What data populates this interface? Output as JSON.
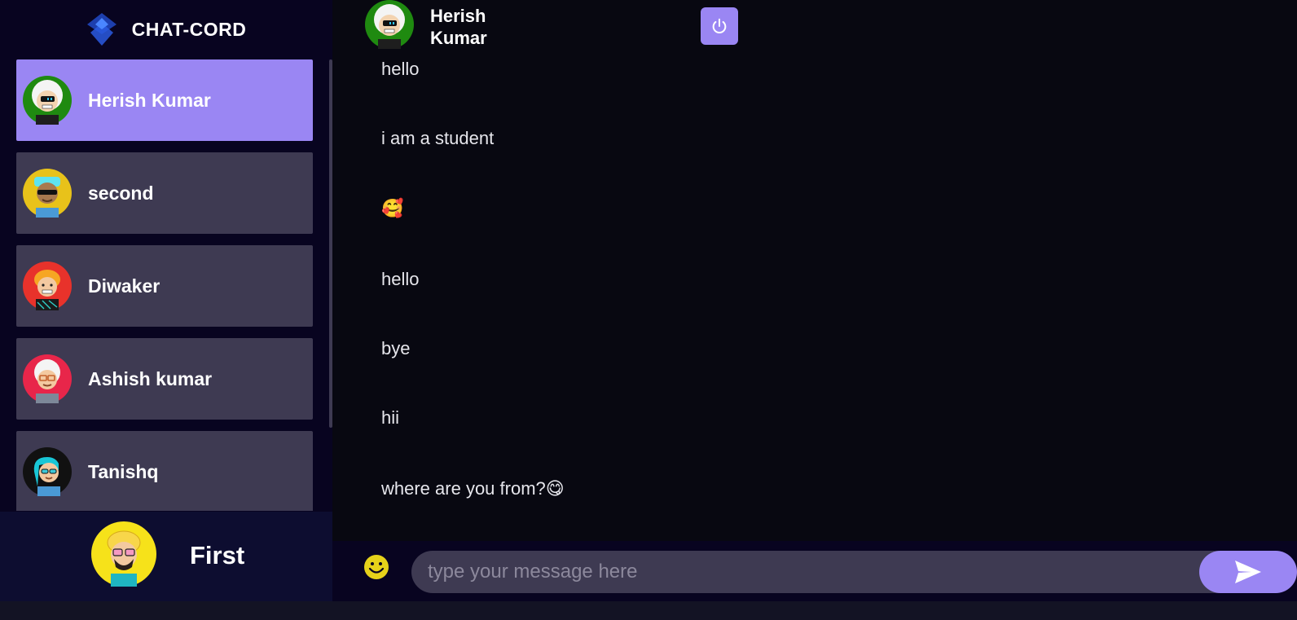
{
  "brand": {
    "name": "CHAT-CORD",
    "logo_icon": "diamond-logo-icon"
  },
  "contacts": [
    {
      "name": "Herish Kumar",
      "selected": true,
      "avatar": "avatar-white-hair-visor-icon",
      "avatar_bg": "#1f8a10"
    },
    {
      "name": "second",
      "selected": false,
      "avatar": "avatar-sunglasses-cyan-hat-icon",
      "avatar_bg": "#e8c21a"
    },
    {
      "name": "Diwaker",
      "selected": false,
      "avatar": "avatar-orange-hair-icon",
      "avatar_bg": "#e8322b"
    },
    {
      "name": "Ashish kumar",
      "selected": false,
      "avatar": "avatar-white-hair-glasses-icon",
      "avatar_bg": "#e8264a"
    },
    {
      "name": "Tanishq",
      "selected": false,
      "avatar": "avatar-teal-hair-sunglasses-icon",
      "avatar_bg": "#111111"
    }
  ],
  "current_user": {
    "name": "First",
    "avatar": "avatar-blond-pink-glasses-icon",
    "avatar_bg": "#f6e21a"
  },
  "chat": {
    "title": "Herish Kumar",
    "logout_icon": "power-icon",
    "messages": [
      "hello",
      "i am a student",
      "🥰",
      "hello",
      "bye",
      "hii",
      "where are you from?😋"
    ]
  },
  "composer": {
    "placeholder": "type your message here",
    "value": "",
    "emoji_icon": "smiley-icon",
    "send_icon": "send-arrow-icon"
  },
  "colors": {
    "accent": "#9a86f3",
    "sidebar_bg": "#080420",
    "card_bg": "#3e3a52",
    "main_bg": "#080811"
  }
}
